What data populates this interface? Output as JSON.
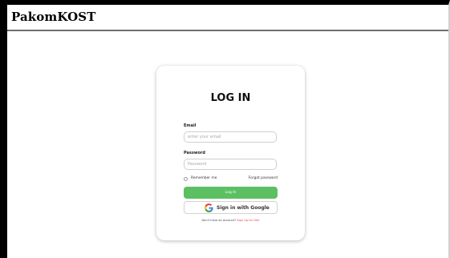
{
  "app": {
    "brand": "PakomKOST"
  },
  "login": {
    "title": "LOG IN",
    "email_label": "Email",
    "email_placeholder": "enter your email",
    "password_label": "Password",
    "password_placeholder": "Password",
    "remember_label": "Remember me",
    "forgot_label": "Forgot password",
    "login_button_label": "Log In",
    "google_button_label": "Sign in with Google",
    "signup_prompt": "Don't have an account? ",
    "signup_link_label": "Sign Up for free"
  },
  "colors": {
    "login_button": "#5cbf62",
    "signup_link": "#e04444",
    "frame_border": "#000000"
  },
  "icons": {
    "google": "google-g-icon"
  }
}
